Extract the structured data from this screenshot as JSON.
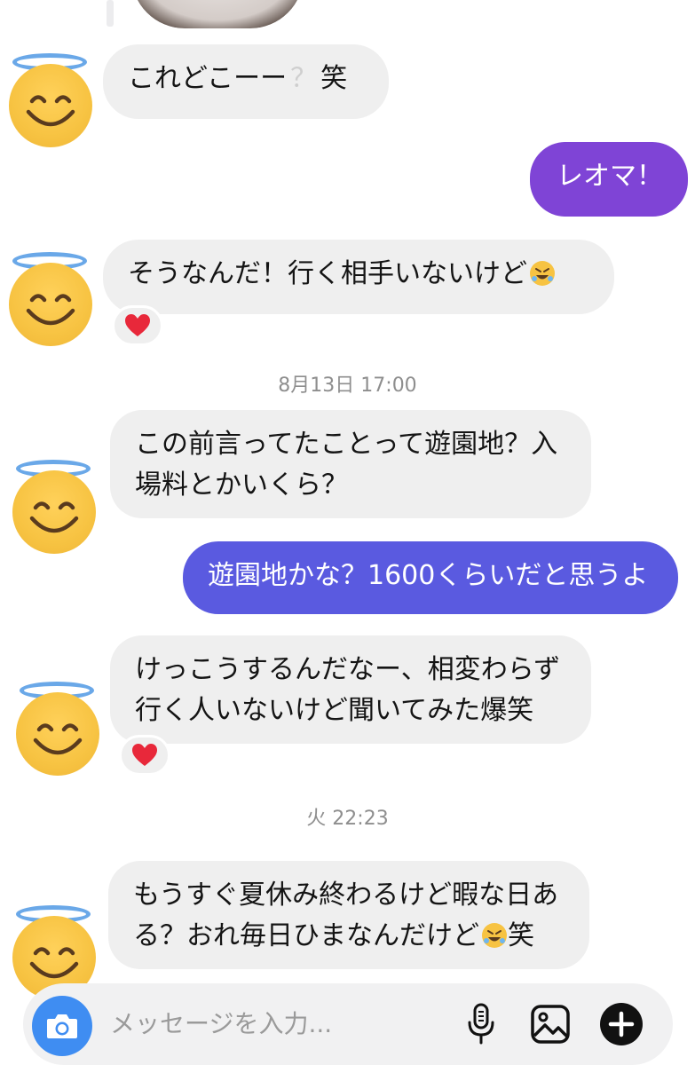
{
  "messages": [
    {
      "from": "them",
      "text": "これどこーー？笑"
    },
    {
      "from": "me",
      "text": "レオマ！",
      "color": "#7f44d6"
    },
    {
      "from": "them",
      "text": "そうなんだ！行く相手いないけど",
      "emoji": "rolling-on-floor-laughing",
      "reaction": "heart"
    },
    {
      "from": "them",
      "text": "この前言ってたことって遊園地？入場料とかいくら？"
    },
    {
      "from": "me",
      "text": "遊園地かな？1600くらいだと思うよ",
      "color": "#5a5ae0"
    },
    {
      "from": "them",
      "text": "けっこうするんだなー、相変わらず行く人いないけど聞いてみた爆笑",
      "reaction": "heart"
    },
    {
      "from": "them",
      "text": "もうすぐ夏休み終わるけど暇な日ある？おれ毎日ひまなんだけど",
      "emoji": "rolling-on-floor-laughing",
      "suffix": "笑"
    }
  ],
  "msg": {
    "m1a": "これどこーー",
    "m1q": "？",
    "m1b": "笑",
    "m2": "レオマ！",
    "m3": "そうなんだ！行く相手いないけど",
    "m4": "この前言ってたことって遊園地？入場料とかいくら？",
    "m5": "遊園地かな？1600くらいだと思うよ",
    "m6": "けっこうするんだなー、相変わらず行く人いないけど聞いてみた爆笑",
    "m7a": "もうすぐ夏休み終わるけど暇な日ある？おれ毎日ひまなんだけど",
    "m7b": "笑"
  },
  "timestamps": {
    "t1": "8月13日 17:00",
    "t2": "火 22:23"
  },
  "composer": {
    "placeholder": "メッセージを入力...",
    "icons": [
      "camera-icon",
      "microphone-icon",
      "gallery-icon",
      "plus-icon"
    ]
  },
  "colors": {
    "bubble_them": "#efefef",
    "bubble_me_1": "#7f44d6",
    "bubble_me_2": "#5a5ae0",
    "timestamp": "#8e8e8e",
    "camera": "#3f8df2"
  },
  "avatar": {
    "icon": "smiling-face-with-halo-icon"
  }
}
